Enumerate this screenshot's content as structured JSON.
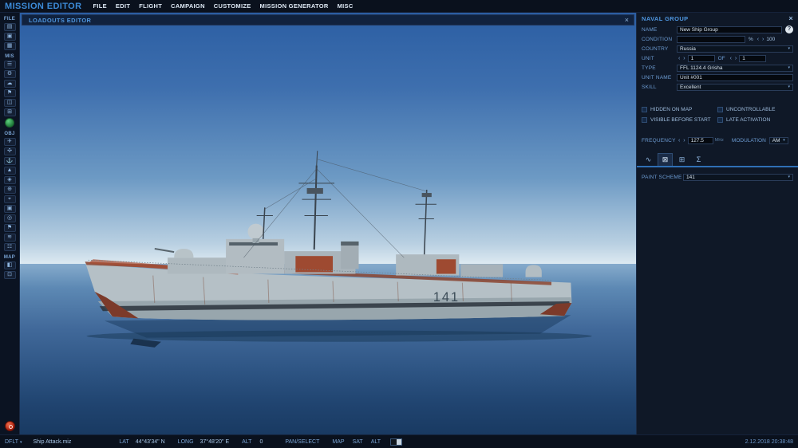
{
  "app": {
    "title": "MISSION EDITOR",
    "menu": [
      "FILE",
      "EDIT",
      "FLIGHT",
      "CAMPAIGN",
      "CUSTOMIZE",
      "MISSION GENERATOR",
      "MISC"
    ],
    "close_glyph": "×"
  },
  "sidebar": {
    "sections": [
      {
        "label": "FILE",
        "icons": [
          {
            "name": "new-mission-icon",
            "glyph": "▤"
          },
          {
            "name": "open-mission-icon",
            "glyph": "▣"
          },
          {
            "name": "save-mission-icon",
            "glyph": "▦"
          }
        ]
      },
      {
        "label": "MIS",
        "icons": [
          {
            "name": "briefing-icon",
            "glyph": "☰"
          },
          {
            "name": "options-icon",
            "glyph": "⚙"
          },
          {
            "name": "weather-icon",
            "glyph": "☁"
          },
          {
            "name": "goals-icon",
            "glyph": "⚑"
          },
          {
            "name": "triggers-icon",
            "glyph": "◫"
          },
          {
            "name": "rules-icon",
            "glyph": "⊞"
          }
        ]
      },
      {
        "label": "OBJ",
        "icons": [
          {
            "name": "aircraft-icon",
            "glyph": "✈"
          },
          {
            "name": "helicopter-icon",
            "glyph": "✣"
          },
          {
            "name": "ship-icon",
            "glyph": "⚓"
          },
          {
            "name": "vehicle-icon",
            "glyph": "▲"
          },
          {
            "name": "static-object-icon",
            "glyph": "◈"
          },
          {
            "name": "template-icon",
            "glyph": "⊕"
          },
          {
            "name": "farp-icon",
            "glyph": "⌖"
          },
          {
            "name": "airfield-icon",
            "glyph": "▣"
          },
          {
            "name": "trigger-zone-icon",
            "glyph": "◎"
          },
          {
            "name": "waypoint-icon",
            "glyph": "⚑"
          },
          {
            "name": "sea-template-icon",
            "glyph": "≋"
          },
          {
            "name": "structure-icon",
            "glyph": "☷"
          }
        ]
      },
      {
        "label": "MAP",
        "icons": [
          {
            "name": "map-layer-icon",
            "glyph": "◧"
          },
          {
            "name": "map-marker-icon",
            "glyph": "⊡"
          }
        ]
      }
    ]
  },
  "viewport": {
    "loadouts_title": "LOADOUTS EDITOR",
    "close_glyph": "×",
    "ship": {
      "hull_number": "141"
    }
  },
  "naval_group": {
    "title": "NAVAL GROUP",
    "close_glyph": "×",
    "fields": {
      "name": {
        "label": "NAME",
        "value": "New Ship Group",
        "help": "?"
      },
      "condition": {
        "label": "CONDITION",
        "value": "",
        "percent": "%",
        "spin": "100"
      },
      "country": {
        "label": "COUNTRY",
        "value": "Russia"
      },
      "unit": {
        "label": "UNIT",
        "count": "1",
        "of": "OF",
        "total": "1"
      },
      "type": {
        "label": "TYPE",
        "value": "FFL 1124.4 Grisha"
      },
      "unit_name": {
        "label": "UNIT NAME",
        "value": "Unit #001"
      },
      "skill": {
        "label": "SKILL",
        "value": "Excellent"
      }
    },
    "checkboxes": [
      {
        "label": "HIDDEN ON MAP"
      },
      {
        "label": "UNCONTROLLABLE"
      },
      {
        "label": "VISIBLE BEFORE START"
      },
      {
        "label": "LATE ACTIVATION"
      }
    ],
    "frequency": {
      "label": "FREQUENCY",
      "value": "127.5",
      "unit": "MHz"
    },
    "modulation": {
      "label": "MODULATION",
      "value": "AM"
    },
    "tabs": [
      {
        "name": "tab-route-icon",
        "glyph": "∿"
      },
      {
        "name": "tab-group-icon",
        "glyph": "⊠"
      },
      {
        "name": "tab-payload-icon",
        "glyph": "⊞"
      },
      {
        "name": "tab-summary-icon",
        "glyph": "Σ"
      }
    ],
    "paint_scheme": {
      "label": "PAINT SCHEME",
      "value": "141"
    },
    "spin_left": "‹",
    "spin_right": "›",
    "dd_arrow": "▾"
  },
  "statusbar": {
    "preset": "DFLT",
    "filename": "Ship Attack.miz",
    "lat_label": "LAT",
    "lat": "44°43'34\" N",
    "long_label": "LONG",
    "long": "37°48'20\" E",
    "alt_label": "ALT",
    "alt": "0",
    "mode": "PAN/SELECT",
    "buttons": [
      "MAP",
      "SAT",
      "ALT"
    ],
    "datetime": "2.12.2018 20:38:48"
  },
  "colors": {
    "accent_blue": "#3c8bd8",
    "panel_bg": "#0f1827",
    "sky_top": "#2b5ea3",
    "sea_bottom": "#193a62",
    "hull_grey": "#b5c0c6",
    "rust_red": "#9e4a31"
  }
}
